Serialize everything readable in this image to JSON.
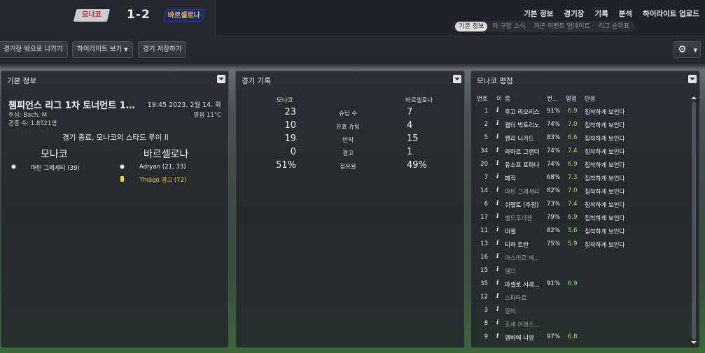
{
  "header": {
    "home_team": "모나코",
    "away_team": "바르셀로나",
    "score": "1-2",
    "nav": [
      "기본 정보",
      "경기장",
      "기록",
      "분석",
      "하이라이트 업로드"
    ],
    "subnav": [
      "기본 정보",
      "타 구장 소식",
      "최근 이벤트 업데이트",
      "리그 순위표"
    ],
    "subnav_active": "기본 정보"
  },
  "toolbar": {
    "leave_label": "경기장 밖으로 나가기",
    "highlights_label": "하이라이트 보기",
    "save_label": "경기 저장하기"
  },
  "basic_info": {
    "panel_title": "기본 정보",
    "match_title": "챔피언스 리그 1차 토너먼트 1…",
    "datetime": "19:45 2023. 2월 14. 화",
    "referee": "주심: Bach, M",
    "weather": "맑음 11°C",
    "attendance": "관중 수: 1.8521명",
    "result_text": "경기 종료, 모나코의 스타드 루이 II",
    "home_name": "모나코",
    "away_name": "바르셀로나",
    "home_events": [
      {
        "type": "goal",
        "text": "마틴 그레세티 (39)"
      }
    ],
    "away_events": [
      {
        "type": "goal",
        "text": "Adryan (21, 33)"
      },
      {
        "type": "yellow-card",
        "text": "Thiago 경고 (72)"
      }
    ]
  },
  "match_stats": {
    "panel_title": "경기 기록",
    "home_header": "모나코",
    "away_header": "바르셀로나",
    "rows": [
      {
        "label": "슈팅 수",
        "home": "23",
        "away": "7"
      },
      {
        "label": "유효 슈팅",
        "home": "10",
        "away": "4"
      },
      {
        "label": "반칙",
        "home": "19",
        "away": "15"
      },
      {
        "label": "경고",
        "home": "0",
        "away": "1"
      },
      {
        "label": "점유율",
        "home": "51%",
        "away": "49%"
      }
    ]
  },
  "ratings": {
    "panel_title": "모나코 평점",
    "columns": {
      "num": "번호",
      "info": "이",
      "name": "름",
      "pct": "컨...",
      "rating": "평점",
      "reaction": "반응"
    },
    "players": [
      {
        "num": "1",
        "name": "후고 리오리스",
        "pct": "91%",
        "rating": "6.9",
        "reaction": "침착하게 보인다",
        "dim": false
      },
      {
        "num": "2",
        "name": "웰터 빅토리노",
        "pct": "74%",
        "rating": "7.0",
        "reaction": "침착하게 보인다",
        "dim": false
      },
      {
        "num": "5",
        "name": "헨리 니가드",
        "pct": "83%",
        "rating": "6.6",
        "reaction": "침착하게 보인다",
        "dim": false
      },
      {
        "num": "34",
        "name": "라마르 그랜더",
        "pct": "74%",
        "rating": "7.4",
        "reaction": "침착하게 보인다",
        "dim": false
      },
      {
        "num": "20",
        "name": "유소프 포파나",
        "pct": "74%",
        "rating": "6.9",
        "reaction": "침착하게 보인다",
        "dim": false
      },
      {
        "num": "7",
        "name": "페직",
        "pct": "68%",
        "rating": "7.3",
        "reaction": "침착하게 보인다",
        "dim": false
      },
      {
        "num": "14",
        "name": "마틴 그레세티",
        "pct": "82%",
        "rating": "7.0",
        "reaction": "침착하게 보인다",
        "dim": true
      },
      {
        "num": "6",
        "name": "쉬헬토 (주장)",
        "pct": "73%",
        "rating": "7.4",
        "reaction": "침착하게 보인다",
        "dim": false
      },
      {
        "num": "17",
        "name": "벨드후이젠",
        "pct": "79%",
        "rating": "6.9",
        "reaction": "침착하게 보인다",
        "dim": true
      },
      {
        "num": "11",
        "name": "미첼",
        "pct": "82%",
        "rating": "5.6",
        "reaction": "침착하게 보인다",
        "dim": false
      },
      {
        "num": "13",
        "name": "티하 트란",
        "pct": "75%",
        "rating": "5.9",
        "reaction": "침착하게 보인다",
        "dim": false
      },
      {
        "num": "16",
        "name": "아스미르 베...",
        "pct": "",
        "rating": "",
        "reaction": "",
        "dim": true
      },
      {
        "num": "15",
        "name": "헬더",
        "pct": "",
        "rating": "",
        "reaction": "",
        "dim": true
      },
      {
        "num": "35",
        "name": "마셀로 시레...",
        "pct": "91%",
        "rating": "6.9",
        "reaction": "",
        "dim": false
      },
      {
        "num": "12",
        "name": "스파타로",
        "pct": "",
        "rating": "",
        "reaction": "",
        "dim": true
      },
      {
        "num": "3",
        "name": "알비",
        "pct": "",
        "rating": "",
        "reaction": "",
        "dim": true
      },
      {
        "num": "8",
        "name": "조세 아덴스...",
        "pct": "",
        "rating": "",
        "reaction": "",
        "dim": true
      },
      {
        "num": "9",
        "name": "엠바에 니앙",
        "pct": "97%",
        "rating": "6.8",
        "reaction": "",
        "dim": false
      }
    ]
  }
}
